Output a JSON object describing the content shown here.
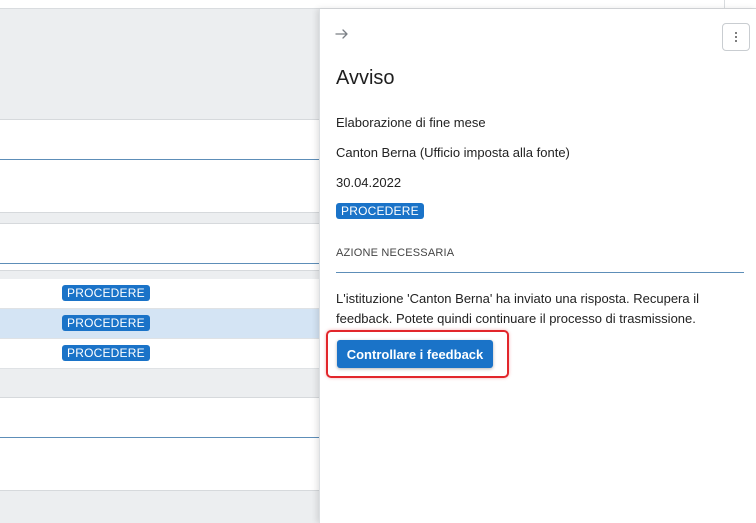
{
  "list": {
    "rows": [
      {
        "status": "PROCEDERE"
      },
      {
        "status": "PROCEDERE"
      },
      {
        "status": "PROCEDERE"
      }
    ]
  },
  "panel": {
    "title": "Avviso",
    "process": "Elaborazione di fine mese",
    "institution": "Canton Berna (Ufficio imposta alla fonte)",
    "date": "30.04.2022",
    "status_badge": "PROCEDERE",
    "section_label": "AZIONE NECESSARIA",
    "message": "L'istituzione 'Canton Berna' ha inviato una risposta. Recupera il feedback. Potete quindi continuare il processo di trasmissione.",
    "action_button": "Controllare i feedback",
    "icons": {
      "back": "arrow-right-icon",
      "more": "more-vertical-icon"
    }
  },
  "colors": {
    "accent": "#1a73c8",
    "highlight": "#e2262b",
    "selected_row": "#d4e4f4",
    "divider": "#5d8eb8"
  }
}
